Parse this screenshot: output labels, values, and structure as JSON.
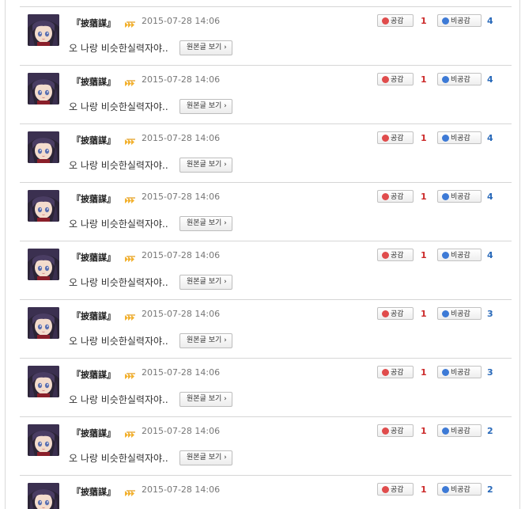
{
  "comments": [
    {
      "author": "『披蕕謀』",
      "date": "2015-07-28 14:06",
      "text": "오 나랑 비슷한실력자야..",
      "original_label": "원본글 보기 ›",
      "like_label": "공감",
      "like_count": "1",
      "dislike_label": "비공감",
      "dislike_count": "4"
    },
    {
      "author": "『披蕕謀』",
      "date": "2015-07-28 14:06",
      "text": "오 나랑 비슷한실력자야..",
      "original_label": "원본글 보기 ›",
      "like_label": "공감",
      "like_count": "1",
      "dislike_label": "비공감",
      "dislike_count": "4"
    },
    {
      "author": "『披蕕謀』",
      "date": "2015-07-28 14:06",
      "text": "오 나랑 비슷한실력자야..",
      "original_label": "원본글 보기 ›",
      "like_label": "공감",
      "like_count": "1",
      "dislike_label": "비공감",
      "dislike_count": "4"
    },
    {
      "author": "『披蕕謀』",
      "date": "2015-07-28 14:06",
      "text": "오 나랑 비슷한실력자야..",
      "original_label": "원본글 보기 ›",
      "like_label": "공감",
      "like_count": "1",
      "dislike_label": "비공감",
      "dislike_count": "4"
    },
    {
      "author": "『披蕕謀』",
      "date": "2015-07-28 14:06",
      "text": "오 나랑 비슷한실력자야..",
      "original_label": "원본글 보기 ›",
      "like_label": "공감",
      "like_count": "1",
      "dislike_label": "비공감",
      "dislike_count": "4"
    },
    {
      "author": "『披蕕謀』",
      "date": "2015-07-28 14:06",
      "text": "오 나랑 비슷한실력자야..",
      "original_label": "원본글 보기 ›",
      "like_label": "공감",
      "like_count": "1",
      "dislike_label": "비공감",
      "dislike_count": "3"
    },
    {
      "author": "『披蕕謀』",
      "date": "2015-07-28 14:06",
      "text": "오 나랑 비슷한실력자야..",
      "original_label": "원본글 보기 ›",
      "like_label": "공감",
      "like_count": "1",
      "dislike_label": "비공감",
      "dislike_count": "3"
    },
    {
      "author": "『披蕕謀』",
      "date": "2015-07-28 14:06",
      "text": "오 나랑 비슷한실력자야..",
      "original_label": "원본글 보기 ›",
      "like_label": "공감",
      "like_count": "1",
      "dislike_label": "비공감",
      "dislike_count": "2"
    },
    {
      "author": "『披蕕謀』",
      "date": "2015-07-28 14:06",
      "text": "",
      "original_label": "",
      "like_label": "공감",
      "like_count": "1",
      "dislike_label": "비공감",
      "dislike_count": "2"
    }
  ],
  "colors": {
    "like": "#e04c4c",
    "dislike": "#3d7ad6",
    "like_count": "#cc2b2b",
    "dislike_count": "#2a6aba"
  },
  "icons": {
    "avatar": "anime-character-avatar",
    "badge": "level-badge-icon",
    "like": "smile-icon",
    "dislike": "frown-icon"
  }
}
